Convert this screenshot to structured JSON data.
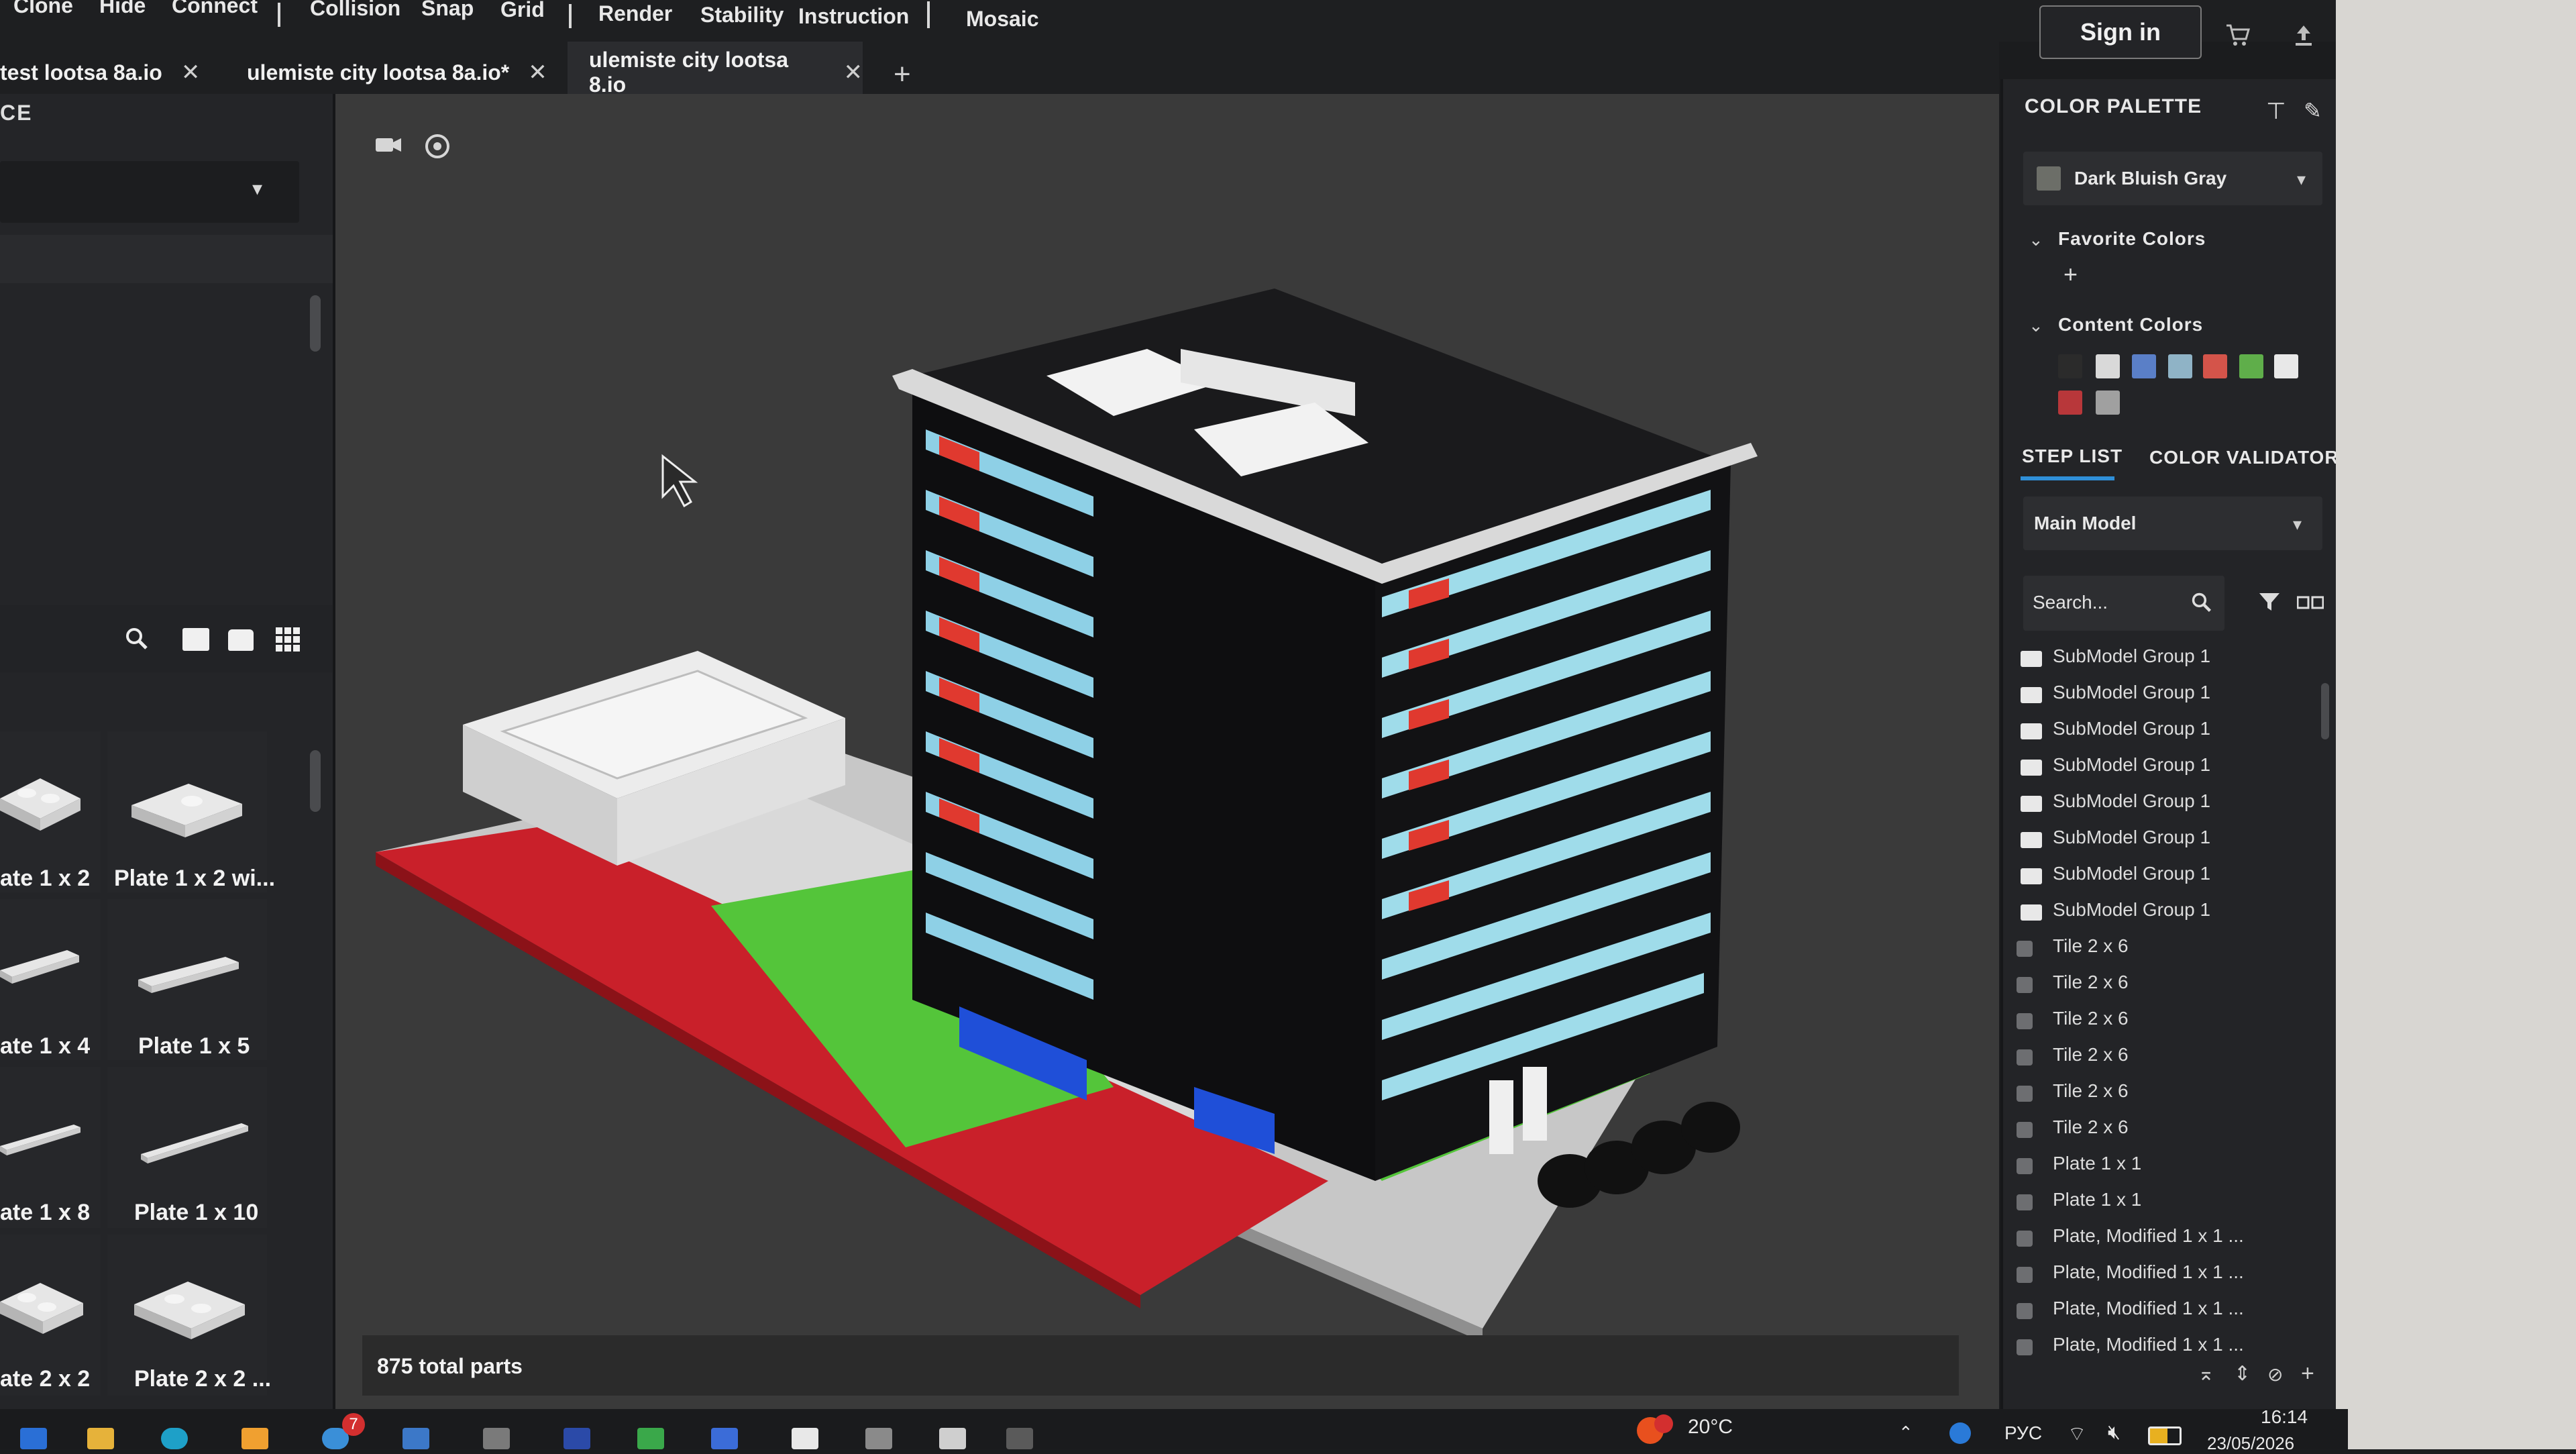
{
  "menu": [
    "Clone",
    "Hide",
    "Connect",
    "Collision",
    "Snap",
    "Grid",
    "Render",
    "Stability",
    "Instruction",
    "Mosaic"
  ],
  "header": {
    "signin_label": "Sign in",
    "cart_icon": "cart-icon",
    "upload_icon": "upload-icon"
  },
  "tabs": [
    {
      "label": "test lootsa 8a.io"
    },
    {
      "label": "ulemiste city lootsa 8a.io*"
    },
    {
      "label": "ulemiste city lootsa 8.io"
    }
  ],
  "left_panel": {
    "title_fragment": "CE",
    "parts": [
      {
        "label": "ate 1 x 2"
      },
      {
        "label": "Plate 1 x 2 wi..."
      },
      {
        "label": "ate 1 x 4"
      },
      {
        "label": "Plate 1 x 5"
      },
      {
        "label": "ate 1 x 8"
      },
      {
        "label": "Plate 1 x 10"
      },
      {
        "label": "ate 2 x 2"
      },
      {
        "label": "Plate 2 x 2 ..."
      }
    ]
  },
  "viewport": {
    "status": "875 total parts"
  },
  "right_panel": {
    "palette_title": "COLOR PALETTE",
    "selected_color": "Dark Bluish Gray",
    "selected_color_hex": "#6c6e68",
    "favorite_colors": "Favorite Colors",
    "content_colors": "Content Colors",
    "content_swatches": [
      "#2b2b2b",
      "#d9d9d9",
      "#5a7fc7",
      "#8fb3c6",
      "#d4544a",
      "#5fae4a",
      "#e8e8e8",
      "#b8373a",
      "#a0a0a0"
    ],
    "tab_step_list": "STEP LIST",
    "tab_color_validator": "COLOR VALIDATOR",
    "model_select": "Main Model",
    "search_placeholder": "Search...",
    "steps": [
      "SubModel Group 1",
      "SubModel Group 1",
      "SubModel Group 1",
      "SubModel Group 1",
      "SubModel Group 1",
      "SubModel Group 1",
      "SubModel Group 1",
      "SubModel Group 1",
      "Tile 2 x 6",
      "Tile 2 x 6",
      "Tile 2 x 6",
      "Tile 2 x 6",
      "Tile 2 x 6",
      "Tile 2 x 6",
      "Plate 1 x 1",
      "Plate 1 x 1",
      "Plate, Modified 1 x 1 ...",
      "Plate, Modified 1 x 1 ...",
      "Plate, Modified 1 x 1 ...",
      "Plate, Modified 1 x 1 ..."
    ]
  },
  "taskbar": {
    "weather": "20°C",
    "notification_count": "7",
    "language": "РУС",
    "time": "16:14",
    "date": "23/05/2026"
  }
}
